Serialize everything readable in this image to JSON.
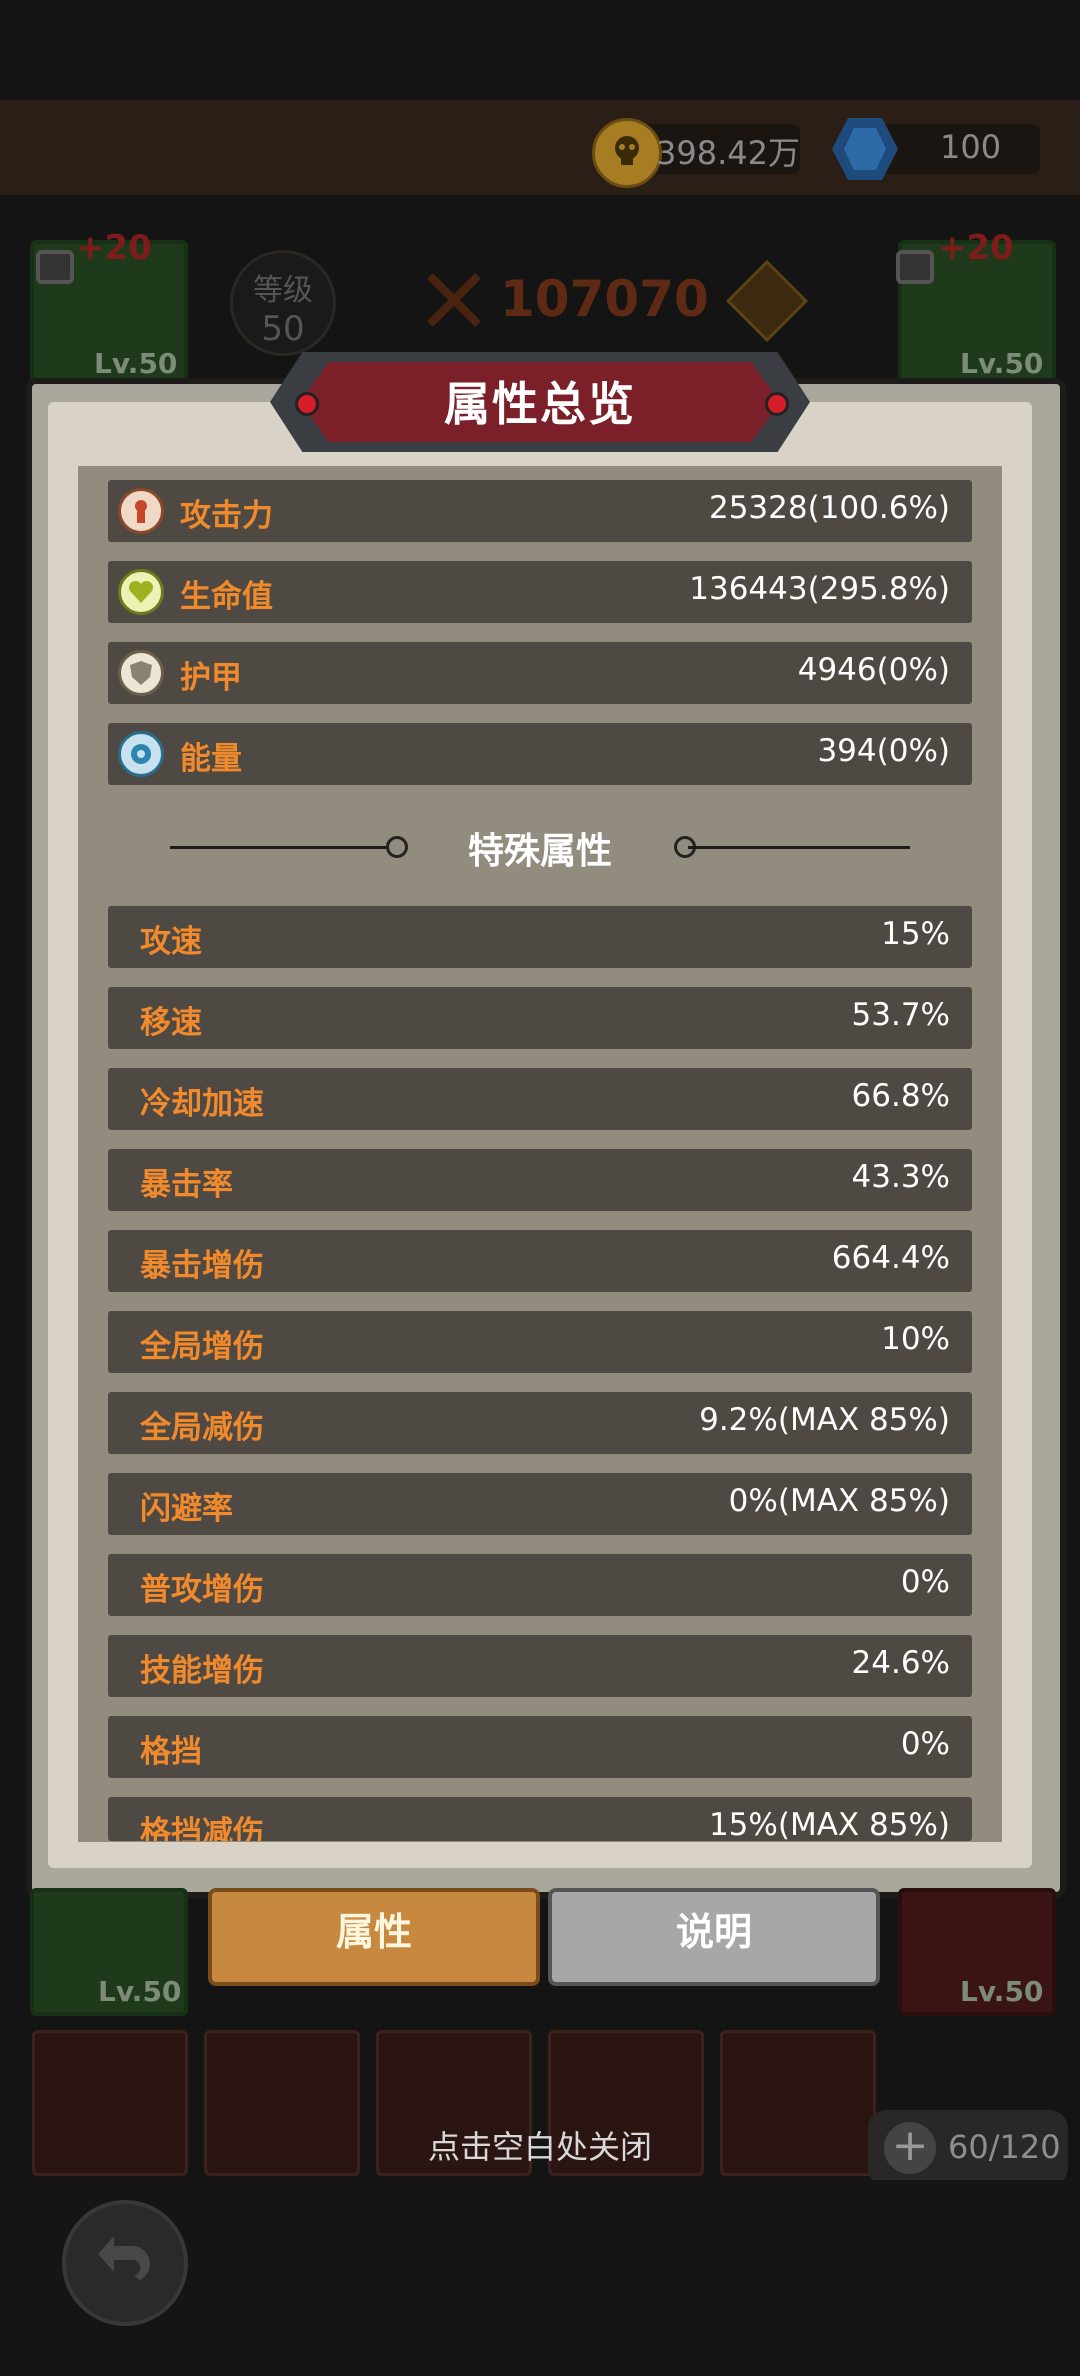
{
  "header": {
    "gold": "398.42万",
    "gems": "100",
    "level_label": "等级",
    "level_value": "50",
    "power": "107070",
    "slot_bonus": "+20",
    "slot_level": "Lv.50"
  },
  "panel": {
    "title": "属性总览",
    "main_stats": [
      {
        "icon": "attack-icon",
        "label": "攻击力",
        "value": "25328(100.6%)"
      },
      {
        "icon": "heart-icon",
        "label": "生命值",
        "value": "136443(295.8%)"
      },
      {
        "icon": "shield-icon",
        "label": "护甲",
        "value": "4946(0%)"
      },
      {
        "icon": "energy-icon",
        "label": "能量",
        "value": "394(0%)"
      }
    ],
    "special_title": "特殊属性",
    "special_stats": [
      {
        "label": "攻速",
        "value": "15%"
      },
      {
        "label": "移速",
        "value": "53.7%"
      },
      {
        "label": "冷却加速",
        "value": "66.8%"
      },
      {
        "label": "暴击率",
        "value": "43.3%"
      },
      {
        "label": "暴击增伤",
        "value": "664.4%"
      },
      {
        "label": "全局增伤",
        "value": "10%"
      },
      {
        "label": "全局减伤",
        "value": "9.2%(MAX 85%)"
      },
      {
        "label": "闪避率",
        "value": "0%(MAX 85%)"
      },
      {
        "label": "普攻增伤",
        "value": "0%"
      },
      {
        "label": "技能增伤",
        "value": "24.6%"
      },
      {
        "label": "格挡",
        "value": "0%"
      },
      {
        "label": "格挡减伤",
        "value": "15%(MAX 85%)"
      }
    ]
  },
  "tabs": {
    "attributes": "属性",
    "description": "说明"
  },
  "footer": {
    "close_hint": "点击空白处关闭",
    "capacity": "60/120",
    "capacity_plus": "+"
  },
  "colors": {
    "label_orange": "#f08a2c",
    "row_bg": "#4e4943",
    "title_red": "#7b1f28"
  }
}
